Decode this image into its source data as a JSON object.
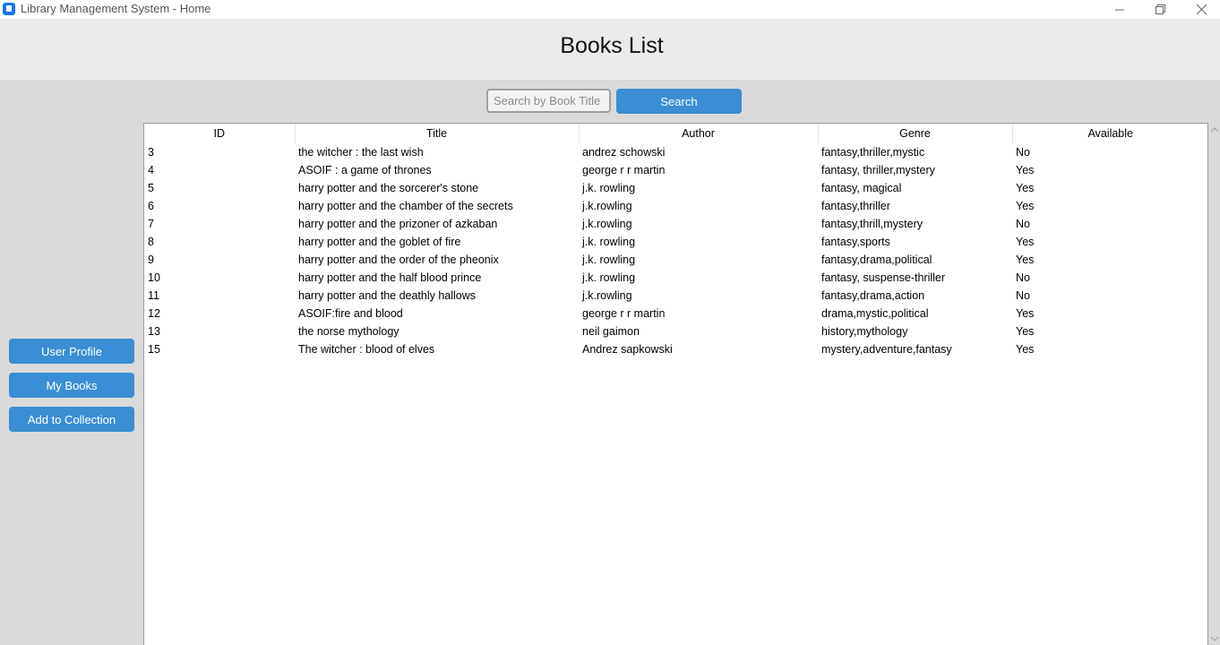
{
  "window": {
    "title": "Library Management System - Home"
  },
  "header": {
    "title": "Books List"
  },
  "search": {
    "placeholder": "Search by Book Title",
    "value": "",
    "button_label": "Search"
  },
  "sidebar": {
    "buttons": [
      {
        "label": "User Profile"
      },
      {
        "label": "My Books"
      },
      {
        "label": "Add to Collection"
      }
    ]
  },
  "table": {
    "columns": [
      "ID",
      "Title",
      "Author",
      "Genre",
      "Available"
    ],
    "rows": [
      [
        "3",
        "the witcher : the last wish",
        "andrez schowski",
        "fantasy,thriller,mystic",
        "No"
      ],
      [
        "4",
        "ASOIF : a game of thrones",
        "george r r martin",
        "fantasy, thriller,mystery",
        "Yes"
      ],
      [
        "5",
        "harry potter and the sorcerer's stone",
        "j.k. rowling",
        "fantasy, magical",
        "Yes"
      ],
      [
        "6",
        "harry potter and the chamber of the secrets",
        "j.k.rowling",
        "fantasy,thriller",
        "Yes"
      ],
      [
        "7",
        "harry potter and the prizoner of azkaban",
        "j.k.rowling",
        "fantasy,thrill,mystery",
        "No"
      ],
      [
        "8",
        "harry potter and the goblet of fire",
        "j.k. rowling",
        "fantasy,sports",
        "Yes"
      ],
      [
        "9",
        "harry potter and the order of the pheonix",
        "j.k. rowling",
        "fantasy,drama,political",
        "Yes"
      ],
      [
        "10",
        "harry potter and the half blood prince",
        "j.k. rowling",
        "fantasy, suspense-thriller",
        "No"
      ],
      [
        "11",
        "harry potter and the deathly hallows",
        "j.k.rowling",
        "fantasy,drama,action",
        "No"
      ],
      [
        "12",
        "ASOIF:fire and blood",
        "george r r martin",
        "drama,mystic,political",
        "Yes"
      ],
      [
        "13",
        "the norse mythology",
        "neil gaimon",
        "history,mythology",
        "Yes"
      ],
      [
        "15",
        "The witcher : blood of elves",
        "Andrez sapkowski",
        "mystery,adventure,fantasy",
        "Yes"
      ]
    ]
  },
  "icons": {
    "app": "app-icon",
    "minimize": "minimize-icon",
    "maximize": "restore-icon",
    "close": "close-icon",
    "scroll_up": "chevron-up-icon",
    "scroll_down": "chevron-down-icon"
  },
  "colors": {
    "accent": "#3b8ed3",
    "header_bg": "#ebebeb",
    "window_bg": "#dadada",
    "table_bg": "#ffffff"
  }
}
